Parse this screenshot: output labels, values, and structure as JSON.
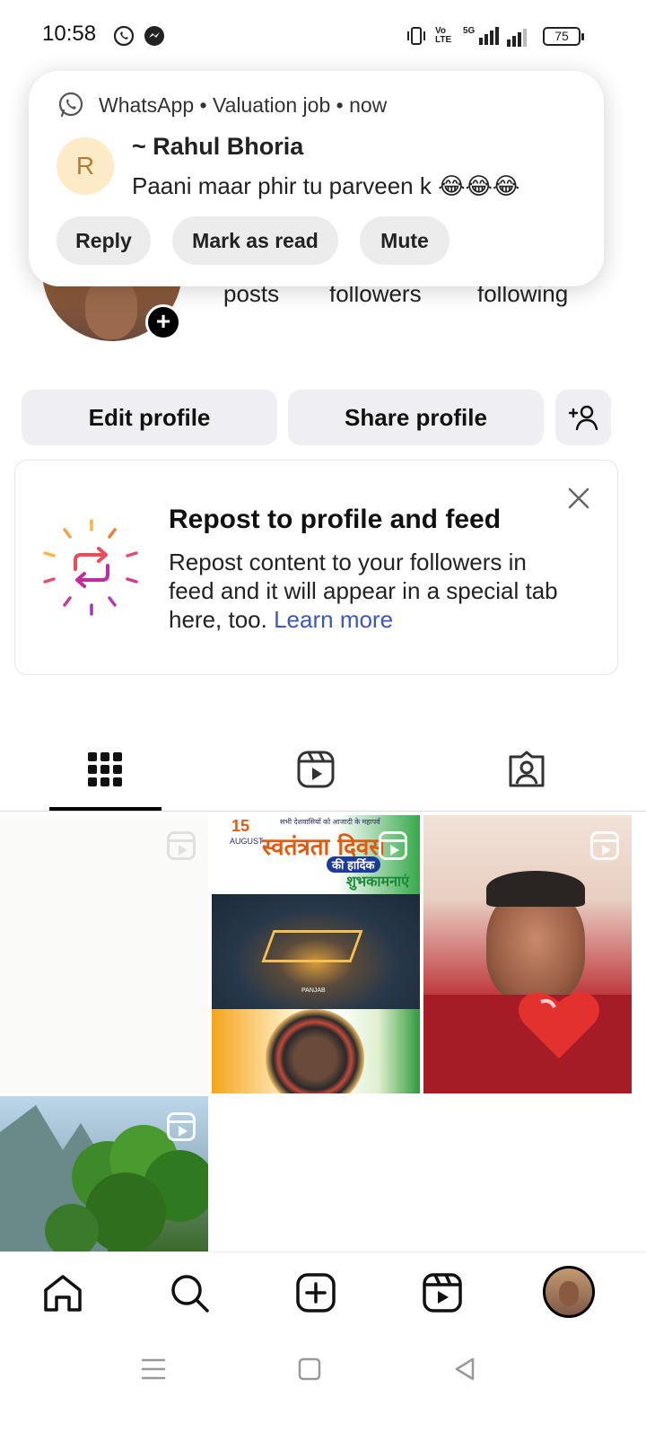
{
  "status_bar": {
    "time": "10:58",
    "battery": "75",
    "network": "5G"
  },
  "notification": {
    "app_name": "WhatsApp",
    "group": "Valuation job",
    "time": "now",
    "avatar_initial": "R",
    "sender": "~ Rahul Bhoria",
    "message": "Paani maar phir tu parveen k 😂😂😂",
    "actions": [
      "Reply",
      "Mark as read",
      "Mute"
    ]
  },
  "profile": {
    "stats": {
      "posts_label": "posts",
      "followers_label": "followers",
      "following_label": "following"
    }
  },
  "buttons": {
    "edit_profile": "Edit profile",
    "share_profile": "Share profile"
  },
  "repost_card": {
    "title": "Repost to profile and feed",
    "body": "Repost content to your followers in feed and it will appear in a special tab here, too.",
    "link": "Learn more"
  },
  "tabs": [
    "grid-icon",
    "reels-icon",
    "tagged-icon"
  ],
  "grid_tiles": [
    {
      "type": "reel",
      "content": "blank"
    },
    {
      "type": "reel",
      "content": "15 AUGUST स्वतंत्रता दिवस की हार्दिक शुभकामनाएं"
    },
    {
      "type": "reel",
      "content": "man with heart effect"
    },
    {
      "type": "reel",
      "content": "mountain forest"
    }
  ],
  "poster": {
    "date": "15",
    "month": "AUGUST",
    "top_line": "सभी देशवासियों को आजादी के महापर्व",
    "headline": "स्वतंत्रता दिवस",
    "sub": "की हार्दिक",
    "sub2": "शुभकामनाएं",
    "place": "PANJAB"
  },
  "bottom_nav": [
    "home-icon",
    "search-icon",
    "create-icon",
    "reels-icon",
    "profile-avatar"
  ],
  "colors": {
    "link_blue": "#3e56c4",
    "button_gray": "#efeff3"
  }
}
